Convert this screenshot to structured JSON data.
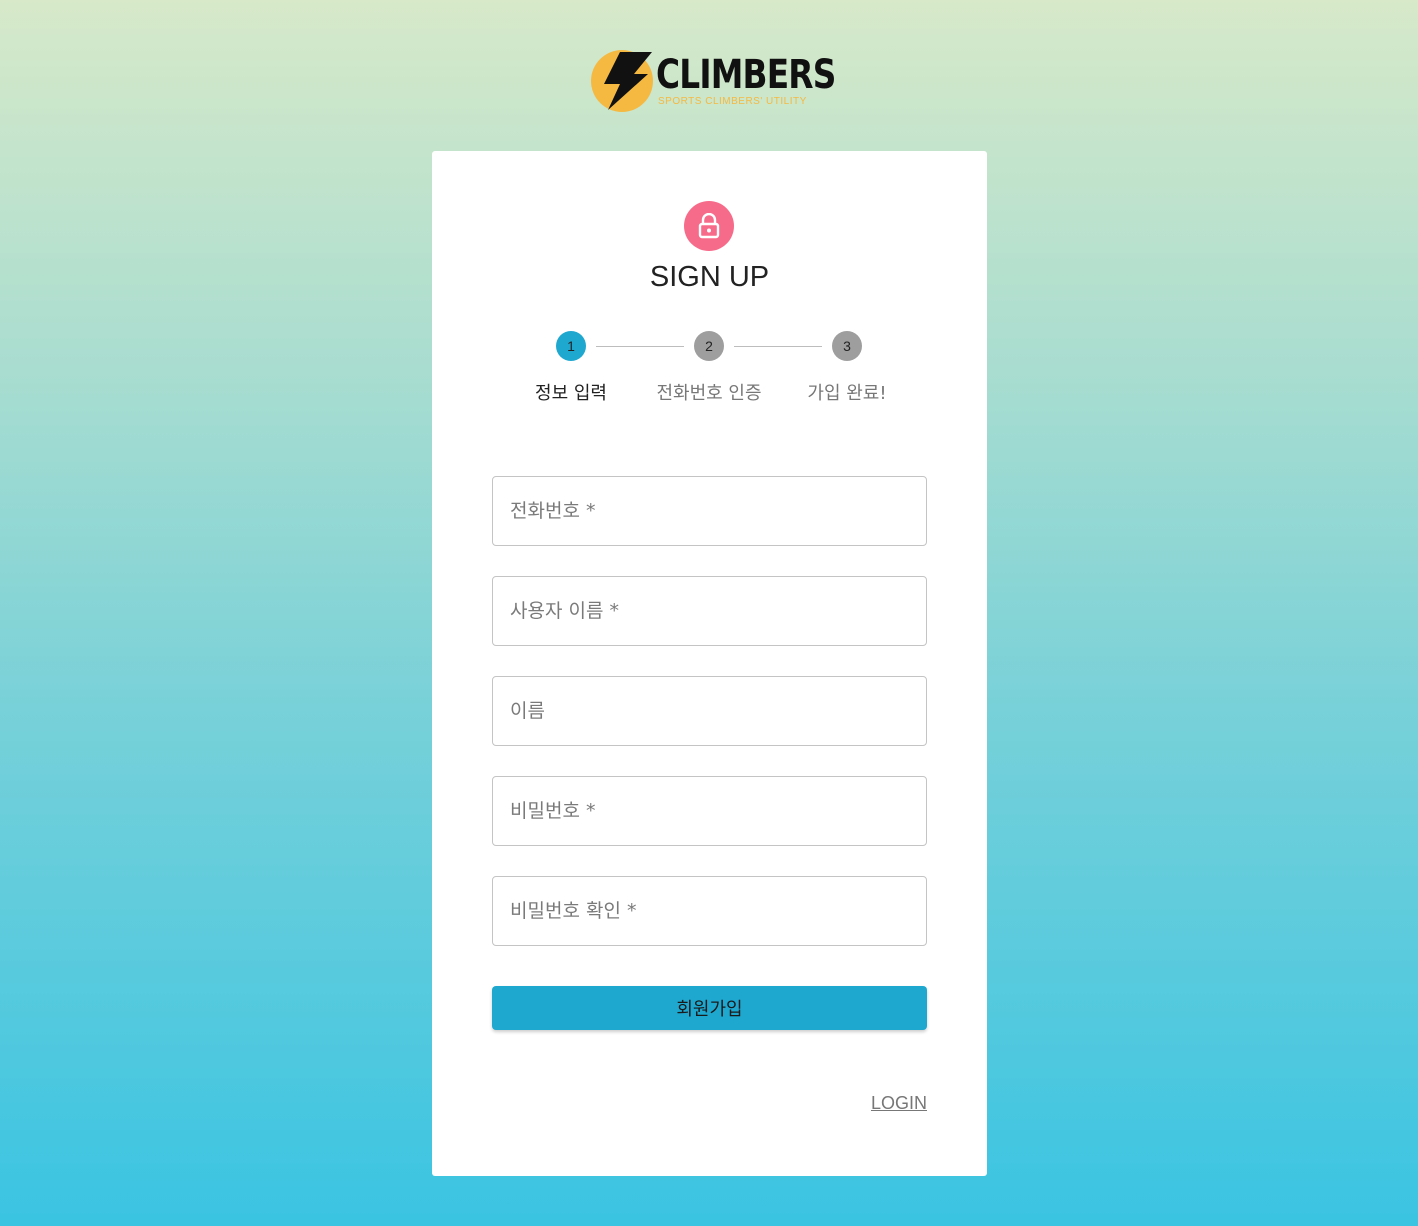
{
  "brand": {
    "name": "CLIMBERS",
    "tagline": "SPORTS CLIMBERS' UTILITY",
    "icon": "lightning-bolt-logo",
    "accent": "#f5b942"
  },
  "card": {
    "lock_icon": "lock-icon",
    "title": "SIGN UP"
  },
  "stepper": {
    "steps": [
      {
        "number": "1",
        "label": "정보 입력",
        "active": true
      },
      {
        "number": "2",
        "label": "전화번호 인증",
        "active": false
      },
      {
        "number": "3",
        "label": "가입 완료!",
        "active": false
      }
    ],
    "active_color": "#1ea8d0",
    "inactive_color": "#9e9e9e"
  },
  "form": {
    "fields": [
      {
        "placeholder": "전화번호 *",
        "value": ""
      },
      {
        "placeholder": "사용자 이름 *",
        "value": ""
      },
      {
        "placeholder": "이름",
        "value": ""
      },
      {
        "placeholder": "비밀번호 *",
        "value": ""
      },
      {
        "placeholder": "비밀번호 확인 *",
        "value": ""
      }
    ],
    "submit_label": "회원가입",
    "login_link": "LOGIN"
  }
}
